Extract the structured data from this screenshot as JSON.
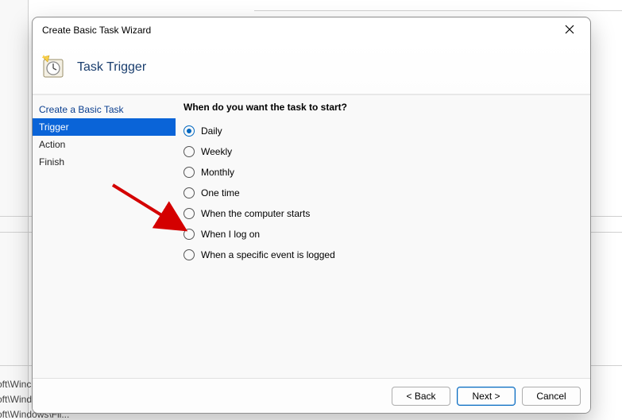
{
  "window": {
    "title": "Create Basic Task Wizard"
  },
  "banner": {
    "title": "Task Trigger"
  },
  "sidebar": {
    "items": [
      {
        "label": "Create a Basic Task",
        "selected": false
      },
      {
        "label": "Trigger",
        "selected": true
      },
      {
        "label": "Action",
        "selected": false
      },
      {
        "label": "Finish",
        "selected": false
      }
    ]
  },
  "main": {
    "question": "When do you want the task to start?",
    "options": [
      {
        "label": "Daily",
        "checked": true
      },
      {
        "label": "Weekly",
        "checked": false
      },
      {
        "label": "Monthly",
        "checked": false
      },
      {
        "label": "One time",
        "checked": false
      },
      {
        "label": "When the computer starts",
        "checked": false
      },
      {
        "label": "When I log on",
        "checked": false
      },
      {
        "label": "When a specific event is logged",
        "checked": false
      }
    ]
  },
  "footer": {
    "back": "< Back",
    "next": "Next >",
    "cancel": "Cancel"
  },
  "bg": {
    "snip1": "oft\\Winc",
    "snip2": "oft\\Windows\\U...",
    "snip3": "oft\\Windows\\Fli..."
  },
  "annotations": {
    "arrow_target": "option-when-i-log-on"
  }
}
